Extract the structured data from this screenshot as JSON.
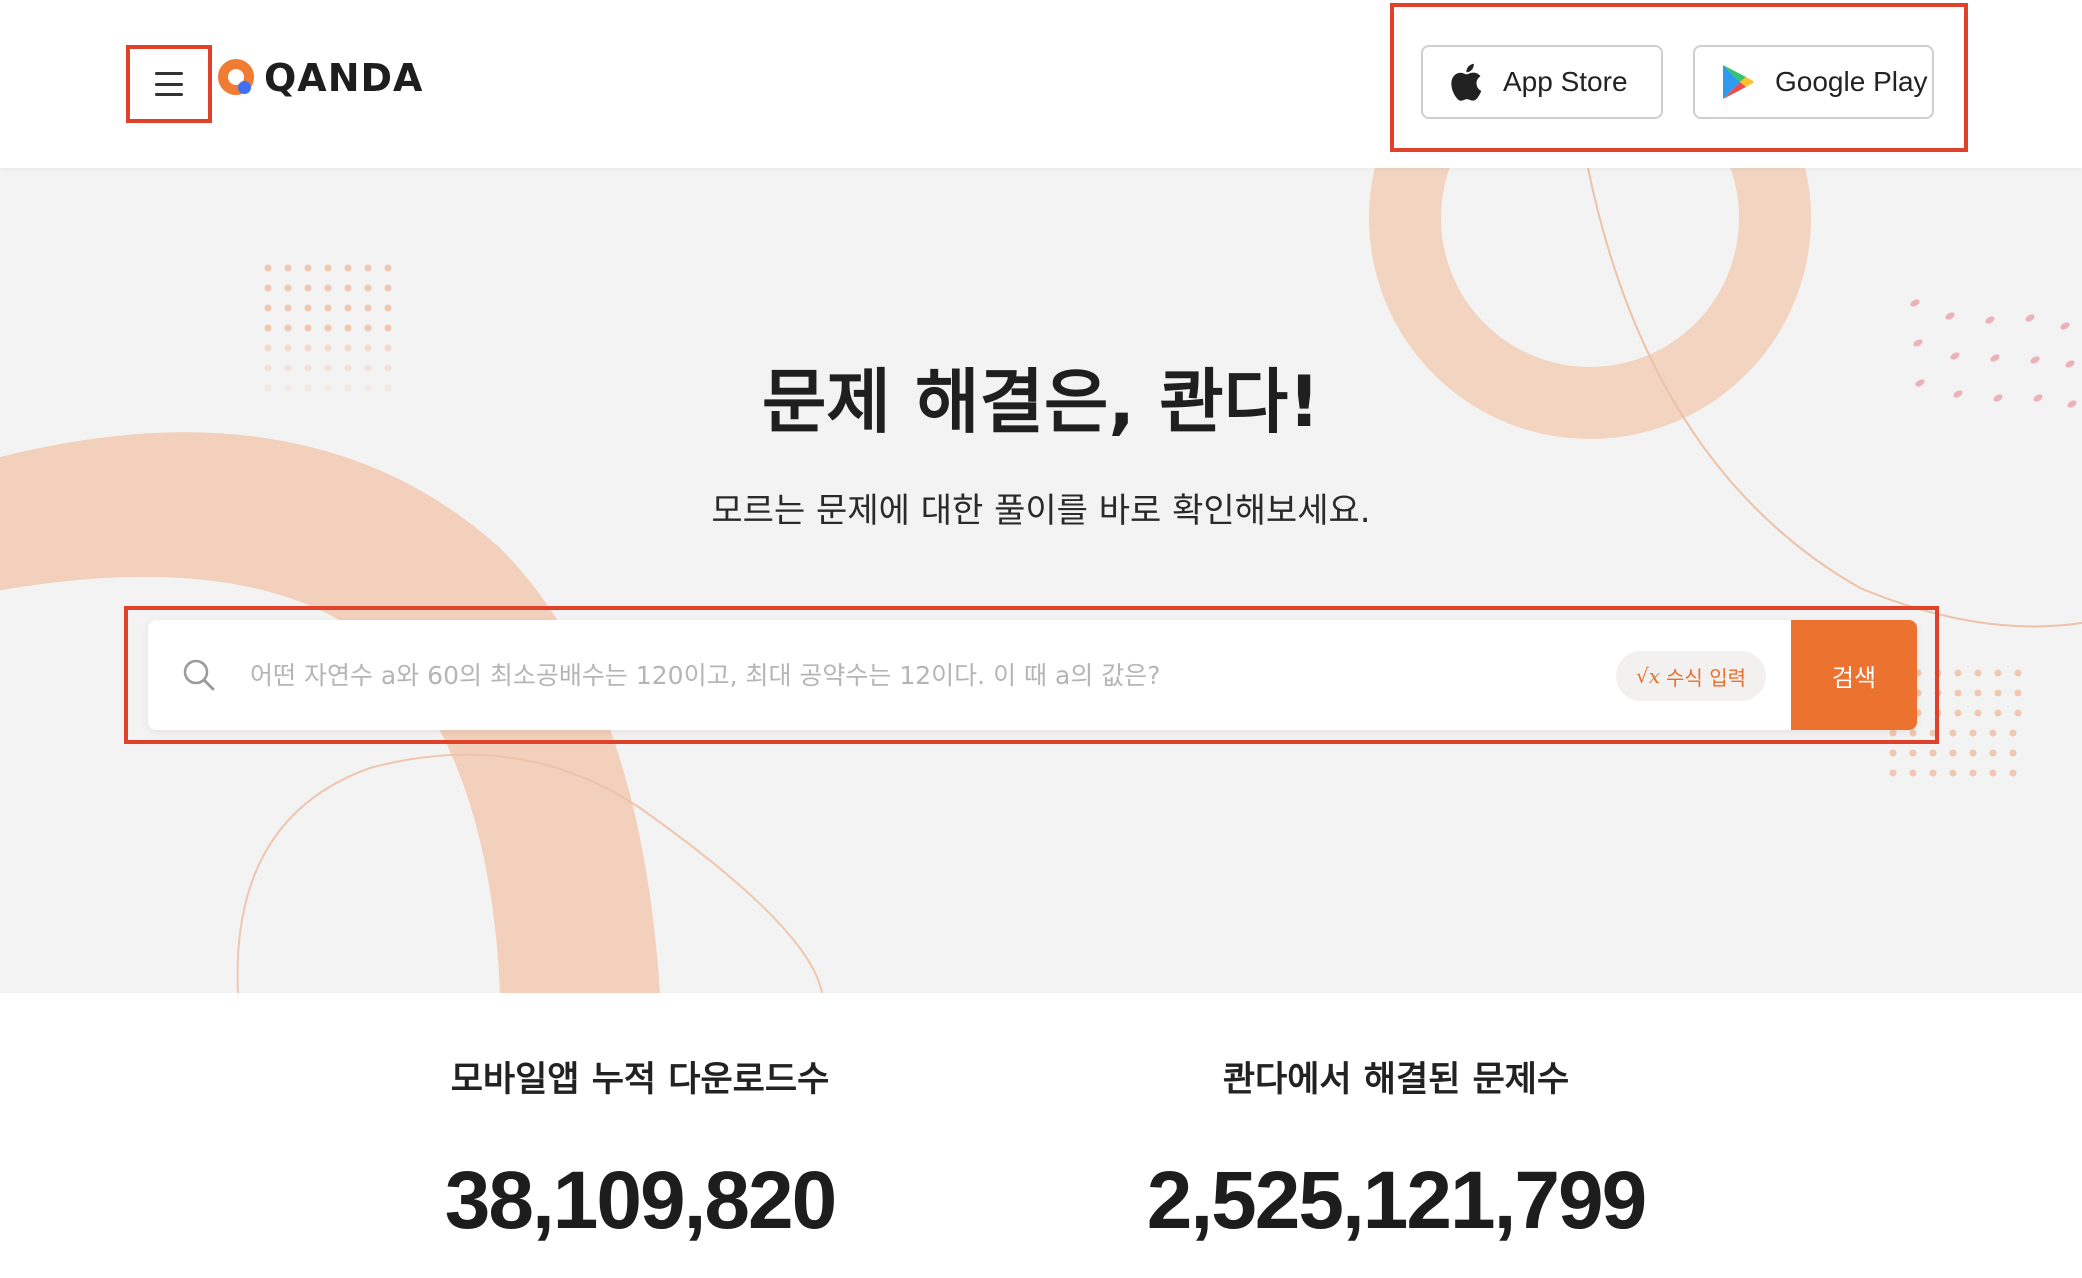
{
  "header": {
    "menu_icon": "hamburger-menu-icon",
    "logo_text": "QANDA",
    "app_store_label": "App Store",
    "google_play_label": "Google Play"
  },
  "hero": {
    "title": "문제 해결은, 콴다!",
    "subtitle": "모르는 문제에 대한 풀이를 바로 확인해보세요."
  },
  "search": {
    "placeholder": "어떤 자연수 a와 60의 최소공배수는 120이고, 최대 공약수는 12이다. 이 때 a의 값은?",
    "value": "",
    "formula_symbol": "√x",
    "formula_label": "수식 입력",
    "button_label": "검색"
  },
  "stats": [
    {
      "label": "모바일앱 누적 다운로드수",
      "value": "38,109,820"
    },
    {
      "label": "콴다에서 해결된 문제수",
      "value": "2,525,121,799"
    }
  ],
  "colors": {
    "accent": "#ec722f",
    "highlight_box": "#e0412a",
    "hero_bg": "#f4f3f3",
    "blob": "#f1c9b0"
  }
}
